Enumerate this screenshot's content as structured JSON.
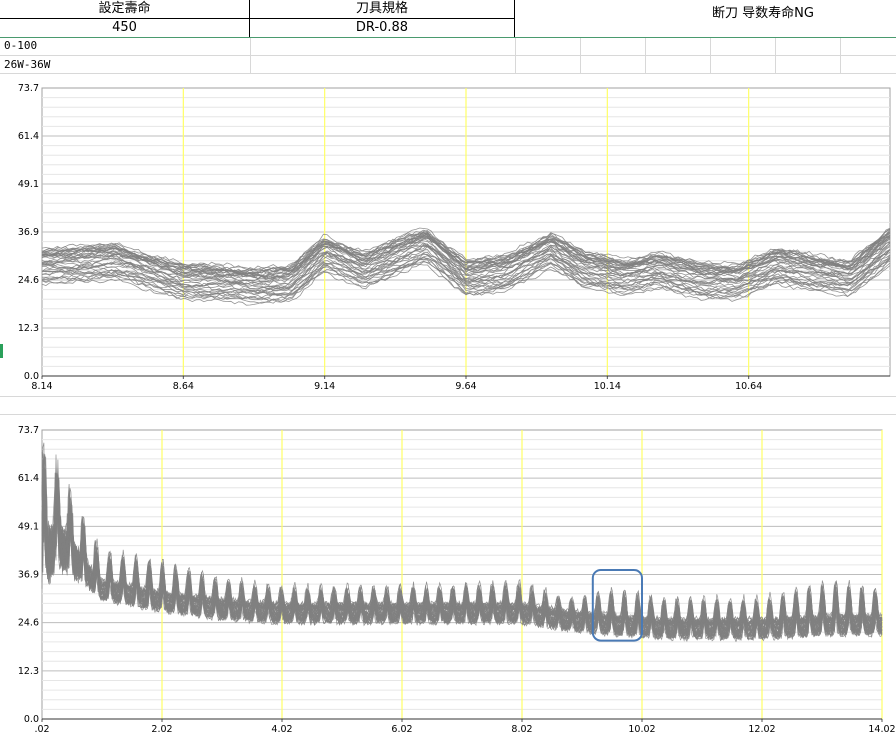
{
  "header": {
    "col1_title": "設定壽命",
    "col1_value": "450",
    "col2_title": "刀具規格",
    "col2_value": "DR-0.88",
    "status_label": "断刀 导数寿命NG"
  },
  "side": {
    "range_label": "0-100",
    "power_label": "26W-36W"
  },
  "colors": {
    "trace": "#808080",
    "marker": "#ffff66",
    "highlight": "#4a7ab5"
  },
  "chart_data": [
    {
      "type": "line",
      "name": "top-chart",
      "x_ticks": [
        "8.14",
        "8.64",
        "9.14",
        "9.64",
        "10.14",
        "10.64"
      ],
      "y_ticks": [
        "0.0",
        "12.3",
        "24.6",
        "36.9",
        "49.1",
        "61.4",
        "73.7"
      ],
      "xlim": [
        8.14,
        11.14
      ],
      "ylim": [
        0,
        73.7
      ],
      "grid": true,
      "vertical_markers": [
        8.64,
        9.14,
        9.64,
        10.14,
        10.64
      ],
      "series_count": 40,
      "centerline": {
        "x": [
          8.14,
          8.4,
          8.64,
          8.9,
          9.02,
          9.14,
          9.28,
          9.42,
          9.5,
          9.64,
          9.78,
          9.94,
          10.06,
          10.2,
          10.32,
          10.48,
          10.6,
          10.74,
          10.88,
          11.0,
          11.14
        ],
        "y": [
          28,
          29,
          24,
          23,
          23.5,
          31,
          27,
          31,
          33,
          25,
          26,
          32,
          27,
          25,
          27,
          24,
          24,
          28,
          26,
          25,
          33
        ]
      },
      "spread": 4.5
    },
    {
      "type": "line",
      "name": "bottom-chart",
      "x_ticks": [
        ".02",
        "2.02",
        "4.02",
        "6.02",
        "8.02",
        "10.02",
        "12.02",
        "14.02"
      ],
      "y_ticks": [
        "0.0",
        "12.3",
        "24.6",
        "36.9",
        "49.1",
        "61.4",
        "73.7"
      ],
      "xlim": [
        0.02,
        14.02
      ],
      "ylim": [
        0,
        73.7
      ],
      "grid": true,
      "vertical_markers": [
        2.02,
        4.02,
        6.02,
        8.02,
        10.02,
        12.02,
        14.02
      ],
      "series_count": 40,
      "envelope": {
        "x": [
          0.02,
          0.3,
          1.0,
          2.0,
          3.0,
          4.0,
          6.0,
          8.0,
          8.8,
          9.6,
          10.4,
          12.0,
          13.2,
          14.02
        ],
        "base": [
          40,
          45,
          33,
          30,
          28,
          27,
          27,
          27,
          25,
          24,
          23,
          23,
          24,
          24
        ],
        "peak": [
          62,
          58,
          40,
          37,
          33,
          31,
          31,
          32,
          28,
          30,
          28,
          28,
          32,
          30
        ]
      },
      "oscillation_period": 0.22,
      "highlight_region": {
        "x": [
          9.2,
          10.02
        ],
        "y": [
          20,
          38
        ]
      }
    }
  ]
}
